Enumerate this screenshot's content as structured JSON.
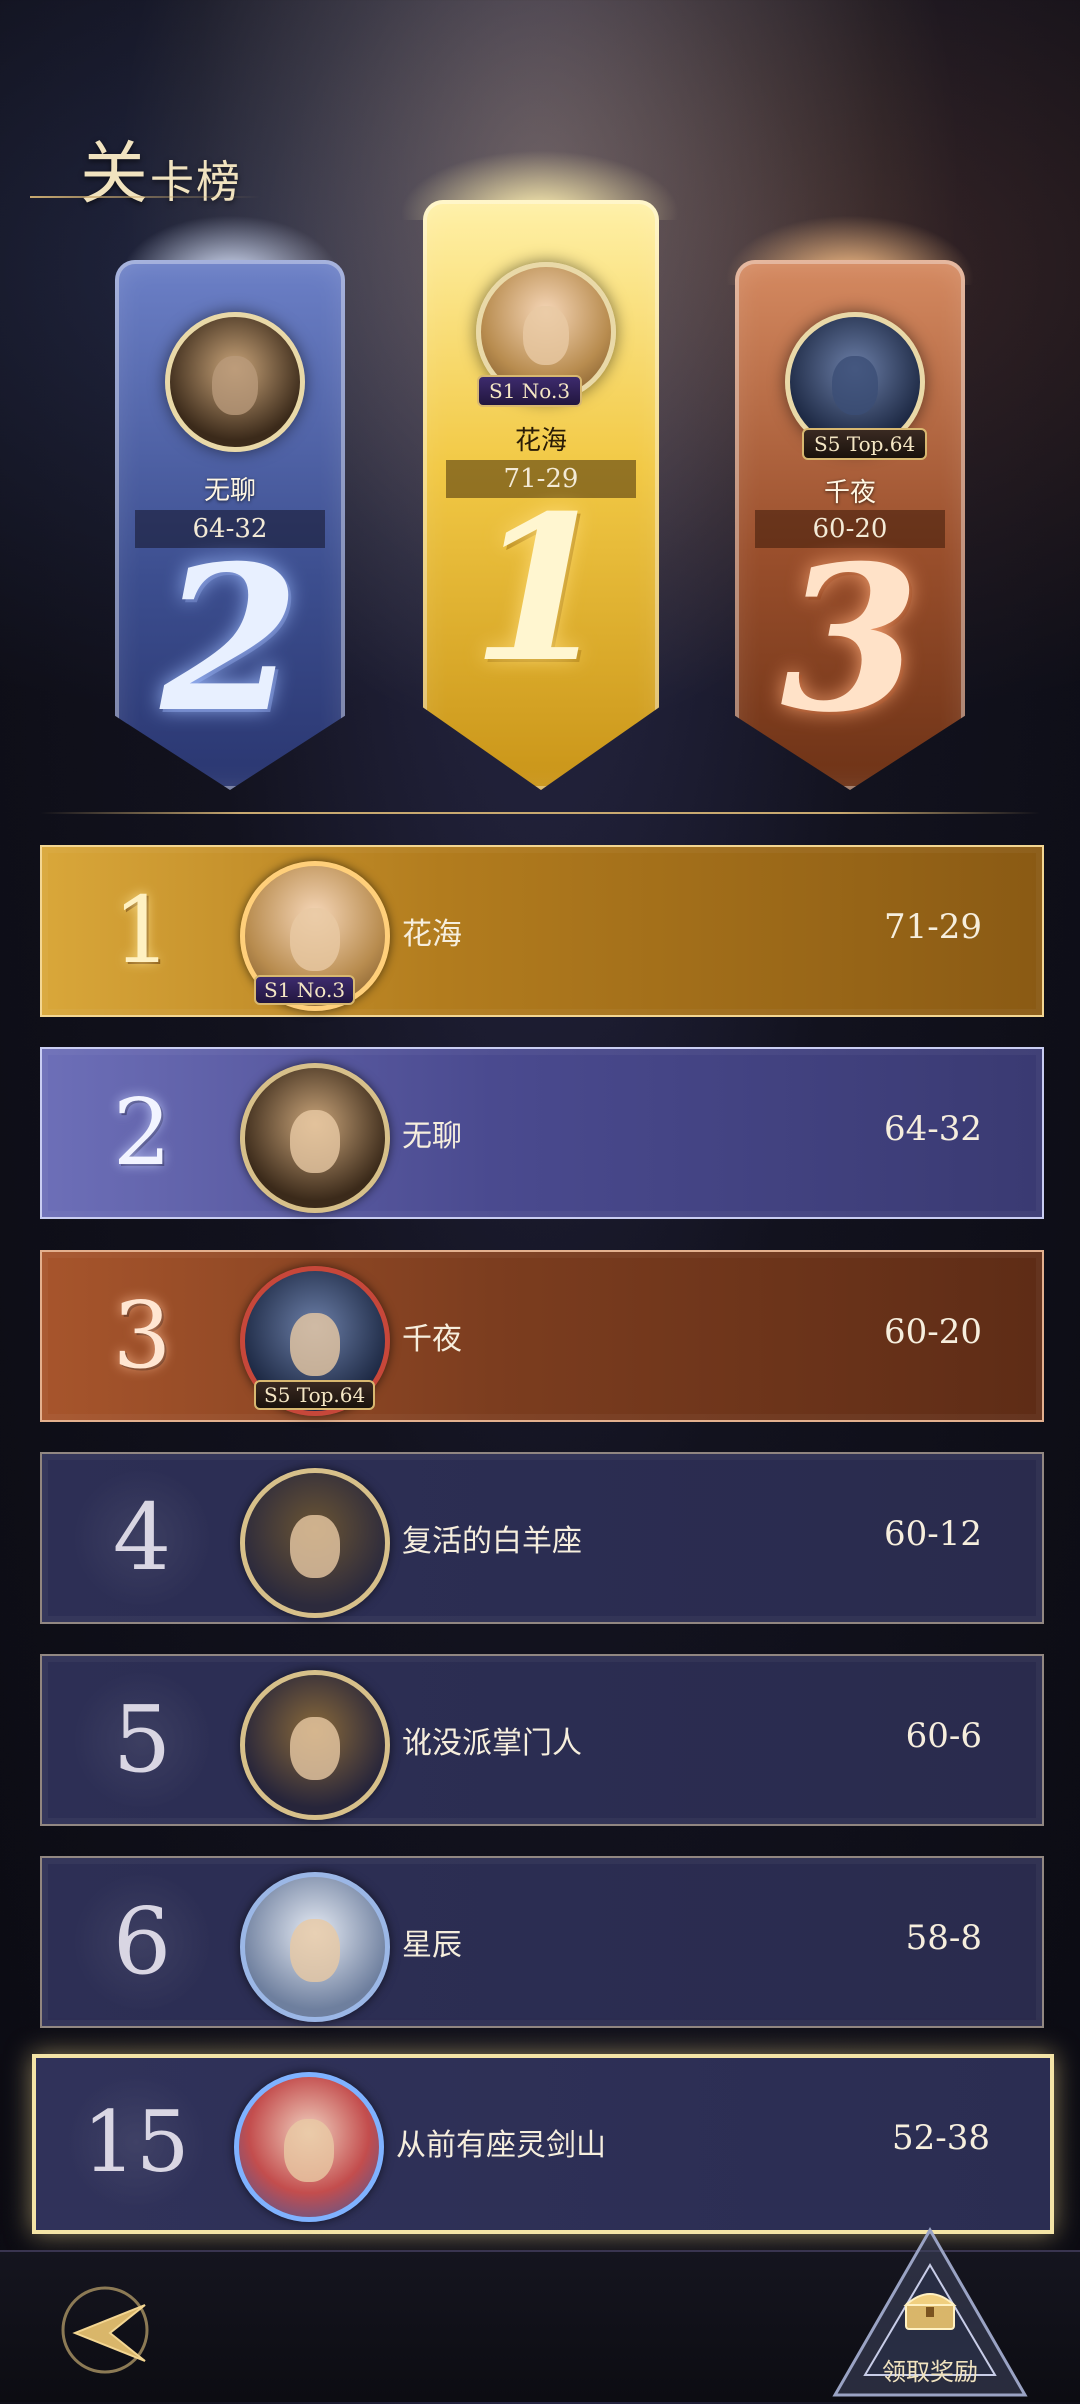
{
  "header": {
    "title_big": "关",
    "title_rest": "卡榜"
  },
  "podium": {
    "second": {
      "name": "无聊",
      "score": "64-32",
      "rank": "2"
    },
    "first": {
      "name": "花海",
      "score": "71-29",
      "rank": "1",
      "badge": "S1 No.3"
    },
    "third": {
      "name": "千夜",
      "score": "60-20",
      "rank": "3",
      "badge": "S5 Top.64"
    }
  },
  "rows": [
    {
      "rank": "1",
      "name": "花海",
      "score": "71-29",
      "badge": "S1 No.3"
    },
    {
      "rank": "2",
      "name": "无聊",
      "score": "64-32"
    },
    {
      "rank": "3",
      "name": "千夜",
      "score": "60-20",
      "badge": "S5 Top.64"
    },
    {
      "rank": "4",
      "name": "复活的白羊座",
      "score": "60-12"
    },
    {
      "rank": "5",
      "name": "讹没派掌门人",
      "score": "60-6"
    },
    {
      "rank": "6",
      "name": "星辰",
      "score": "58-8"
    },
    {
      "rank": "15",
      "name": "从前有座灵剑山",
      "score": "52-38"
    }
  ],
  "footer": {
    "reward_label": "领取奖励"
  },
  "colors": {
    "gold": "#d9a73a",
    "silver": "#6d6fb8",
    "bronze": "#a7552c",
    "plain": "#2d2f55",
    "accent": "#f1e3bf"
  }
}
